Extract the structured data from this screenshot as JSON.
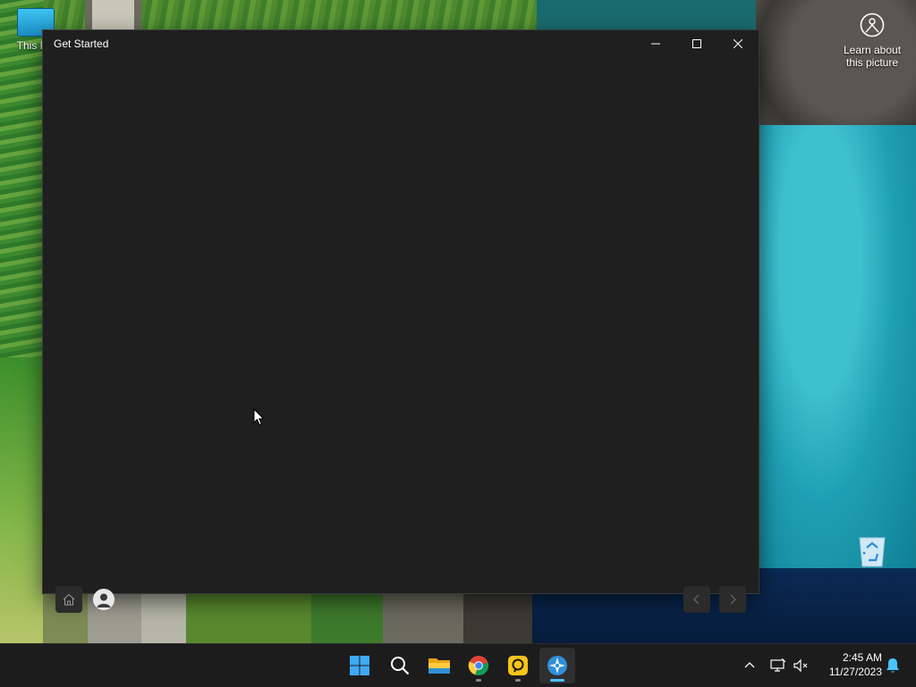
{
  "desktop": {
    "icons": [
      {
        "label": "This PC"
      },
      {
        "label": "Learn about this picture"
      },
      {
        "label": "Recycle Bin"
      }
    ]
  },
  "window": {
    "title": "Get Started",
    "controls": {
      "minimize": "minimize-icon",
      "maximize": "maximize-icon",
      "close": "close-icon"
    },
    "footer": {
      "home": "home-icon",
      "account": "person-icon",
      "back": "chevron-left-icon",
      "next": "chevron-right-icon"
    }
  },
  "taskbar": {
    "apps": [
      {
        "name": "Start",
        "icon": "windows-logo-icon"
      },
      {
        "name": "Search",
        "icon": "search-icon"
      },
      {
        "name": "File Explorer",
        "icon": "folder-icon"
      },
      {
        "name": "Google Chrome",
        "icon": "chrome-icon"
      },
      {
        "name": "App",
        "icon": "yellow-app-icon"
      },
      {
        "name": "Get Started",
        "icon": "get-started-icon"
      }
    ],
    "tray": {
      "time": "2:45 AM",
      "date": "11/27/2023"
    }
  },
  "colors": {
    "window_bg": "#1f1f1f",
    "taskbar_bg": "#1c1c1c",
    "accent": "#4cc2ff"
  }
}
